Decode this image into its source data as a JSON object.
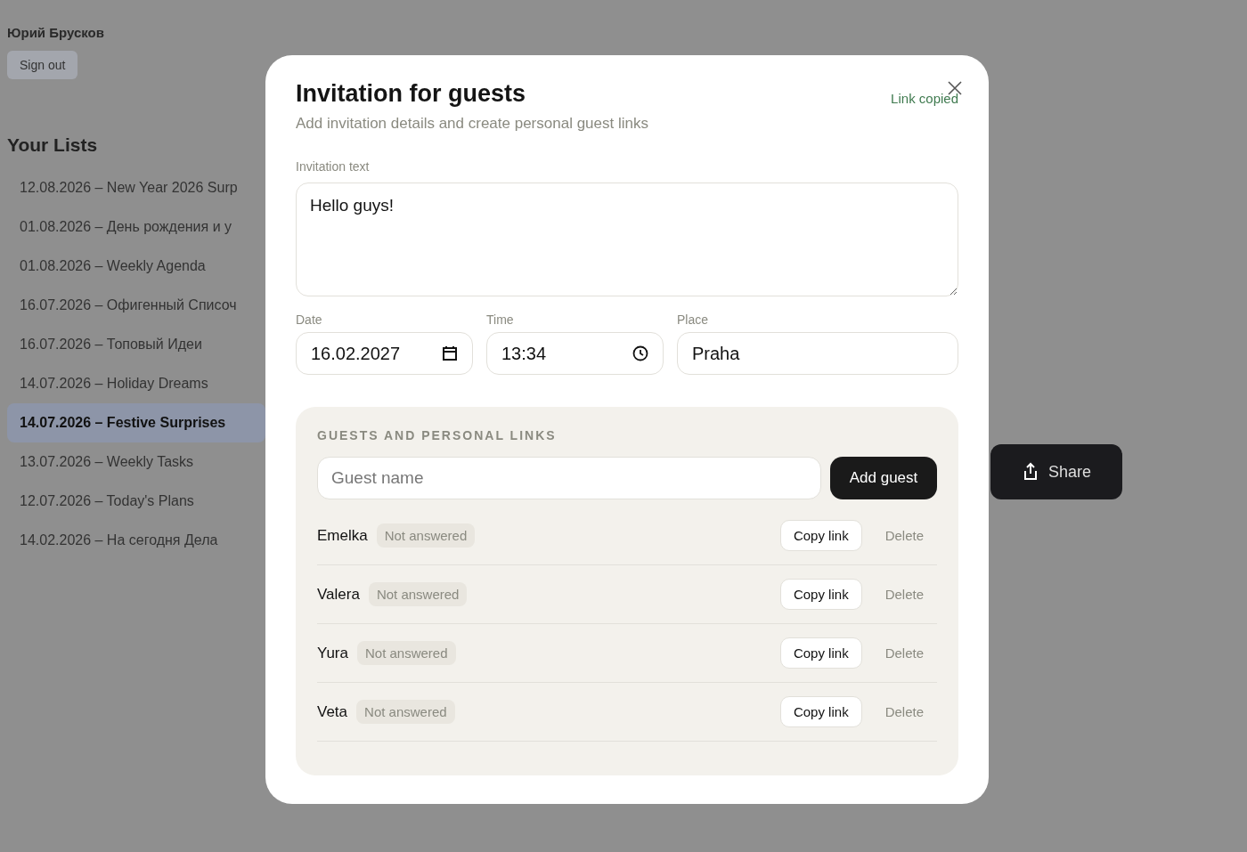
{
  "background": {
    "user_name": "Юрий Брусков",
    "sign_out": "Sign out",
    "lists_title": "Your Lists",
    "lists": [
      {
        "label": "12.08.2026 – New Year 2026 Surp",
        "selected": false
      },
      {
        "label": "01.08.2026 – День рождения и у",
        "selected": false
      },
      {
        "label": "01.08.2026 – Weekly Agenda",
        "selected": false
      },
      {
        "label": "16.07.2026 – Офигенный Списоч",
        "selected": false
      },
      {
        "label": "16.07.2026 – Топовый Идеи",
        "selected": false
      },
      {
        "label": "14.07.2026 – Holiday Dreams",
        "selected": false
      },
      {
        "label": "14.07.2026 – Festive Surprises",
        "selected": true
      },
      {
        "label": "13.07.2026 – Weekly Tasks",
        "selected": false
      },
      {
        "label": "12.07.2026 – Today's Plans",
        "selected": false
      },
      {
        "label": "14.02.2026 – На сегодня Дела",
        "selected": false
      }
    ],
    "share_button": "Share"
  },
  "dialog": {
    "title": "Invitation for guests",
    "subtitle": "Add invitation details and create personal guest links",
    "status": "Link copied",
    "invitation_label": "Invitation text",
    "invitation_value": "Hello guys!",
    "date_label": "Date",
    "date_value": "16.02.2027",
    "time_label": "Time",
    "time_value": "13:34",
    "place_label": "Place",
    "place_value": "Praha",
    "guests": {
      "heading": "GUESTS AND PERSONAL LINKS",
      "name_placeholder": "Guest name",
      "add_button": "Add guest",
      "rows": [
        {
          "name": "Emelka",
          "status": "Not answered",
          "copy": "Copy link",
          "delete": "Delete"
        },
        {
          "name": "Valera",
          "status": "Not answered",
          "copy": "Copy link",
          "delete": "Delete"
        },
        {
          "name": "Yura",
          "status": "Not answered",
          "copy": "Copy link",
          "delete": "Delete"
        },
        {
          "name": "Veta",
          "status": "Not answered",
          "copy": "Copy link",
          "delete": "Delete"
        }
      ]
    }
  }
}
